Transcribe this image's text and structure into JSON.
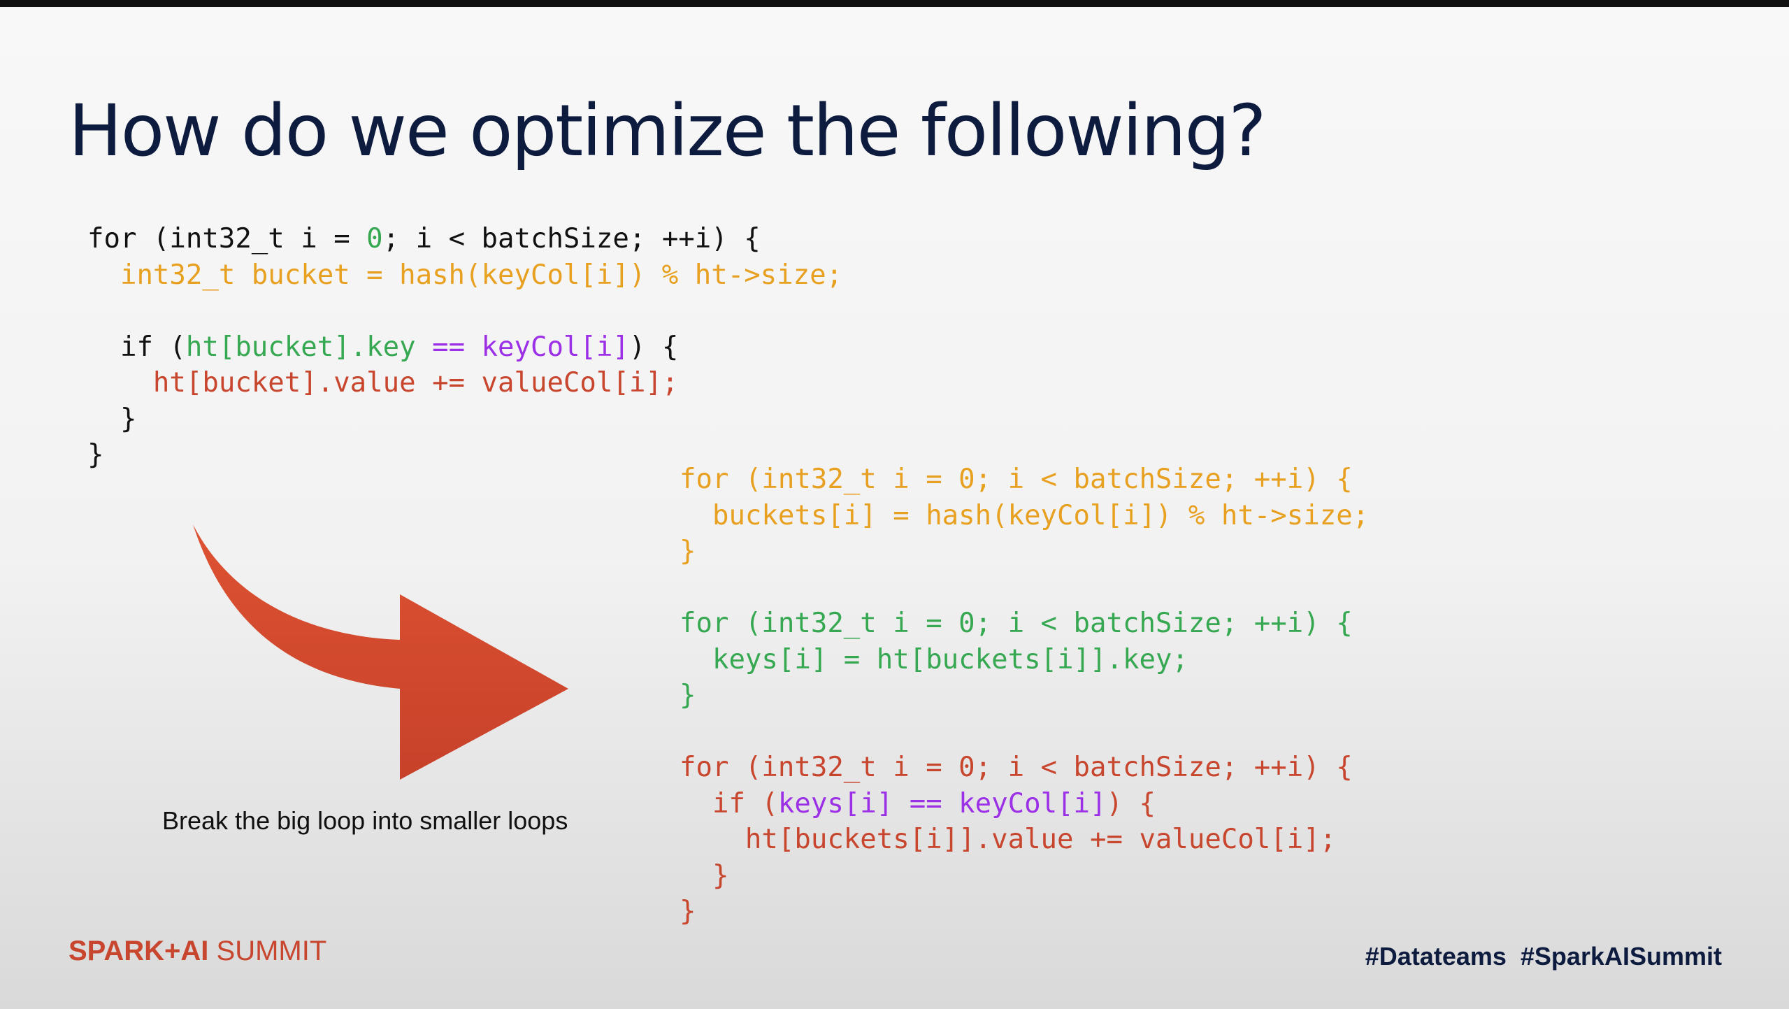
{
  "slide": {
    "title": "How do we optimize the following?",
    "caption": "Break the big loop into smaller loops",
    "logo": {
      "part1": "SPARK+AI",
      "part2": " SUMMIT"
    },
    "hashtags": "#Datateams  #SparkAISummit"
  },
  "code_original": {
    "lines": [
      [
        {
          "t": "for (int32_t i = ",
          "c": "black"
        },
        {
          "t": "0",
          "c": "green"
        },
        {
          "t": "; i < batchSize; ++i) {",
          "c": "black"
        }
      ],
      [
        {
          "t": "  int32_t bucket = hash(keyCol[i]) % ht->size;",
          "c": "orange"
        }
      ],
      [
        {
          "t": "",
          "c": "black"
        }
      ],
      [
        {
          "t": "  if (",
          "c": "black"
        },
        {
          "t": "ht[bucket].key",
          "c": "green"
        },
        {
          "t": " == ",
          "c": "purple"
        },
        {
          "t": "keyCol[i]",
          "c": "purple"
        },
        {
          "t": ") {",
          "c": "black"
        }
      ],
      [
        {
          "t": "    ht[bucket].value += valueCol[i];",
          "c": "red"
        }
      ],
      [
        {
          "t": "  }",
          "c": "black"
        }
      ],
      [
        {
          "t": "}",
          "c": "black"
        }
      ]
    ]
  },
  "code_optimized": {
    "lines": [
      [
        {
          "t": "for (int32_t i = 0; i < batchSize; ++i) {",
          "c": "orange"
        }
      ],
      [
        {
          "t": "  buckets[i] = hash(keyCol[i]) % ht->size;",
          "c": "orange"
        }
      ],
      [
        {
          "t": "}",
          "c": "orange"
        }
      ],
      [
        {
          "t": "",
          "c": "black"
        }
      ],
      [
        {
          "t": "for (int32_t i = 0; i < batchSize; ++i) {",
          "c": "green"
        }
      ],
      [
        {
          "t": "  keys[i] = ht[buckets[i]].key;",
          "c": "green"
        }
      ],
      [
        {
          "t": "}",
          "c": "green"
        }
      ],
      [
        {
          "t": "",
          "c": "black"
        }
      ],
      [
        {
          "t": "for (int32_t i = 0; i < batchSize; ++i) {",
          "c": "red"
        }
      ],
      [
        {
          "t": "  if (",
          "c": "red"
        },
        {
          "t": "keys[i] == keyCol[i]",
          "c": "purple"
        },
        {
          "t": ") {",
          "c": "red"
        }
      ],
      [
        {
          "t": "    ht[buckets[i]].value += valueCol[i];",
          "c": "red"
        }
      ],
      [
        {
          "t": "  }",
          "c": "red"
        }
      ],
      [
        {
          "t": "}",
          "c": "red"
        }
      ]
    ]
  },
  "colors": {
    "title": "#0d1b3e",
    "code_black": "#111111",
    "code_orange": "#e8a020",
    "code_green": "#36a852",
    "code_purple": "#9b30e6",
    "code_red": "#c8452e",
    "arrow": "#d24a2c",
    "logo": "#c8452e"
  },
  "icons": {
    "arrow": "curved-arrow-right-icon"
  }
}
